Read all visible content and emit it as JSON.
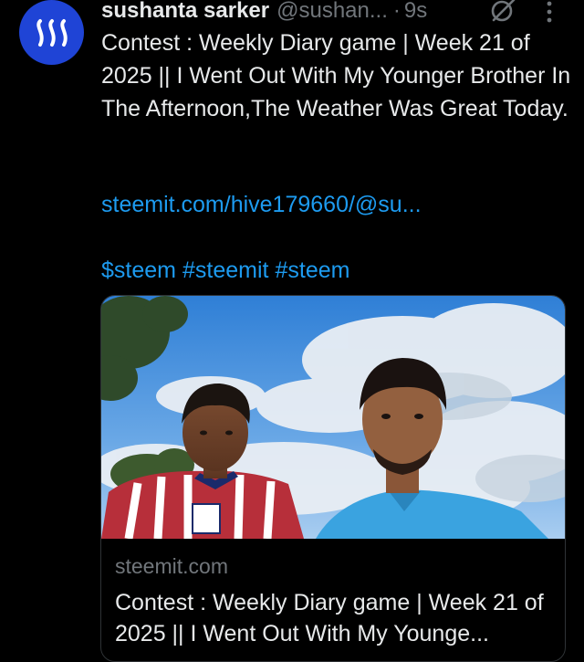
{
  "post": {
    "author_name": "sushanta sarker",
    "author_handle": "@sushan...",
    "separator": "·",
    "time": "9s",
    "text": "Contest : Weekly Diary game | Week 21 of 2025 || I Went Out With My Younger Brother In The Afternoon,The Weather Was Great Today.",
    "link": "steemit.com/hive179660/@su...",
    "hashtags": [
      "$steem",
      "#steemit",
      "#steem"
    ],
    "avatar_icon": "steem-logo-icon",
    "actions": [
      "grok-icon",
      "more-vertical-icon"
    ]
  },
  "card": {
    "domain": "steemit.com",
    "title": "Contest : Weekly Diary game | Week 21 of 2025 || I Went Out With My Younge..."
  },
  "colors": {
    "background": "#000000",
    "text_primary": "#e7e9ea",
    "text_secondary": "#71767b",
    "link": "#1d9bf0",
    "avatar": "#1f44d6"
  }
}
